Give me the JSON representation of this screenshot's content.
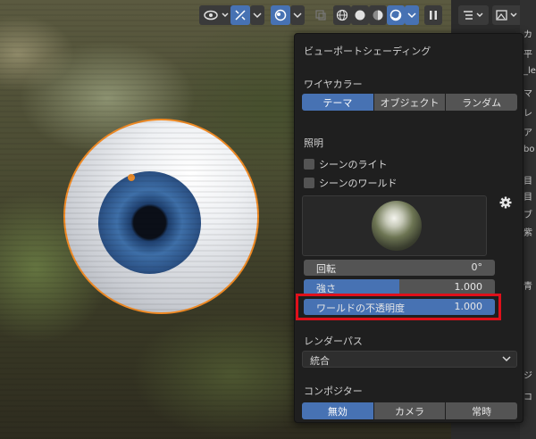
{
  "popup": {
    "title": "ビューポートシェーディング",
    "wire_color": {
      "label": "ワイヤカラー",
      "options": [
        "テーマ",
        "オブジェクト",
        "ランダム"
      ],
      "selected": "テーマ"
    },
    "lighting": {
      "label": "照明",
      "scene_lights": "シーンのライト",
      "scene_world": "シーンのワールド",
      "rotation": {
        "name": "回転",
        "value": "0°"
      },
      "strength": {
        "name": "強さ",
        "value": "1.000",
        "fill_fraction": 0.5
      },
      "world_opacity": {
        "name": "ワールドの不透明度",
        "value": "1.000",
        "fill_fraction": 1.0
      }
    },
    "render_pass": {
      "label": "レンダーパス",
      "value": "統合"
    },
    "compositor": {
      "label": "コンポジター",
      "options": [
        "無効",
        "カメラ",
        "常時"
      ],
      "selected": "無効"
    }
  },
  "right_panel": {
    "partial_labels": [
      "カ",
      "平",
      "_le",
      "マ",
      "レ",
      "ア",
      "bo",
      "目",
      "目",
      "ブ",
      "紫",
      "青",
      "ジ",
      "コ"
    ]
  },
  "colors": {
    "accent": "#4772b3",
    "highlight": "#e0101a",
    "selection_outline": "#f08a24"
  }
}
